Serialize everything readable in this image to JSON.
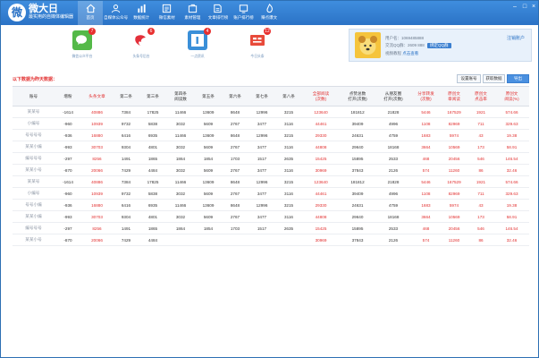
{
  "app": {
    "title": "微大日",
    "subtitle": "最实用的自媒体编辑器"
  },
  "nav": [
    {
      "label": "首页",
      "icon": "home-icon"
    },
    {
      "label": "自媒体公众号",
      "icon": "account-icon"
    },
    {
      "label": "数据统计",
      "icon": "stats-icon"
    },
    {
      "label": "微信素材",
      "icon": "material-icon"
    },
    {
      "label": "素材管理",
      "icon": "manage-icon"
    },
    {
      "label": "文章排行榜",
      "icon": "ranking-icon"
    },
    {
      "label": "账户排行榜",
      "icon": "account-rank-icon"
    },
    {
      "label": "赚点爆文",
      "icon": "hot-icon"
    }
  ],
  "window_controls": [
    "–",
    "□",
    "×"
  ],
  "cards": [
    {
      "label": "微信公众平台",
      "badge": "7",
      "icon": "wechat-icon",
      "color": "#54b948"
    },
    {
      "label": "头条号后台",
      "badge": "6",
      "icon": "toutiao-icon",
      "color": "#ffffff"
    },
    {
      "label": "一点资讯",
      "badge": "4",
      "icon": "yidian-icon",
      "color": "#3a8fd8"
    },
    {
      "label": "今日头条",
      "badge": "12",
      "icon": "jinri-icon",
      "color": "#e84a3a"
    }
  ],
  "profile": {
    "user_line": "用户名：1069485888",
    "qq_line": "交流QQ群：2609 888",
    "bind_label": "绑定QQ群",
    "tip_line": "视频教程",
    "tip_link": "点击查看",
    "logout_label": "注销账户"
  },
  "section_title": "以下数据为昨天数据：",
  "toolbar": {
    "settings_label": "设置账号",
    "fetch_label": "获取数据",
    "export_label": "导出"
  },
  "table": {
    "headers": [
      "账号",
      "增粉",
      "头条文章",
      "第二条",
      "第三条",
      "第四条\n阅读数",
      "第五条",
      "第六条",
      "第七条",
      "第八条",
      "全部阅读\n(次数)",
      "点赞总数\n打开(次数)",
      "从朋友圈\n打开(次数)",
      "分享转发\n(次数)",
      "原创文\n章阅读",
      "原创文\n点击率",
      "原创文\n阅读(%)"
    ],
    "red_columns": [
      2,
      10,
      13,
      14,
      15,
      16
    ],
    "rows": [
      [
        "某某号",
        "-1614",
        "40886",
        "7384",
        "17825",
        "11466",
        "13609",
        "8648",
        "12996",
        "3215",
        "123640",
        "181812",
        "21828",
        "5446",
        "167529",
        "1921",
        "574.66"
      ],
      [
        "小编号",
        "-960",
        "10939",
        "9732",
        "5838",
        "3032",
        "5609",
        "2767",
        "3477",
        "3116",
        "44461",
        "39409",
        "4996",
        "1108",
        "82969",
        "711",
        "329.63"
      ],
      [
        "号号号号",
        "-936",
        "16880",
        "6416",
        "6935",
        "11466",
        "13609",
        "8648",
        "12996",
        "3215",
        "29330",
        "24631",
        "4759",
        "1683",
        "5974",
        "43",
        "19.38"
      ],
      [
        "某某小编",
        "-993",
        "30703",
        "9304",
        "4801",
        "3032",
        "5609",
        "2767",
        "3477",
        "3116",
        "44808",
        "29640",
        "18168",
        "3664",
        "10569",
        "173",
        "58.91"
      ],
      [
        "编号号号",
        "-297",
        "8256",
        "1491",
        "1865",
        "1864",
        "1854",
        "1703",
        "1517",
        "2635",
        "15425",
        "15895",
        "2533",
        "468",
        "20456",
        "546",
        "146.54"
      ],
      [
        "某某小号",
        "-870",
        "20066",
        "7429",
        "4484",
        "3032",
        "5609",
        "2767",
        "3477",
        "3116",
        "30969",
        "37843",
        "2126",
        "574",
        "11260",
        "86",
        "32.46"
      ],
      [
        "某某号",
        "-1614",
        "40886",
        "7384",
        "17825",
        "11466",
        "13609",
        "8648",
        "12996",
        "3215",
        "123640",
        "181812",
        "21828",
        "5446",
        "167529",
        "1921",
        "574.66"
      ],
      [
        "小编号",
        "-960",
        "10939",
        "9732",
        "5838",
        "3032",
        "5609",
        "2767",
        "3477",
        "3116",
        "44461",
        "39409",
        "4996",
        "1108",
        "82969",
        "711",
        "329.63"
      ],
      [
        "号号小编",
        "-936",
        "16880",
        "6416",
        "6935",
        "11466",
        "13609",
        "8648",
        "12996",
        "3215",
        "29330",
        "24631",
        "4759",
        "1683",
        "5974",
        "43",
        "19.38"
      ],
      [
        "某某小编",
        "-993",
        "30703",
        "9304",
        "4801",
        "3032",
        "5609",
        "2767",
        "3477",
        "3116",
        "44808",
        "29640",
        "18168",
        "3664",
        "10569",
        "173",
        "58.91"
      ],
      [
        "编号号号",
        "-297",
        "8256",
        "1491",
        "1865",
        "1864",
        "1854",
        "1703",
        "1517",
        "2635",
        "15425",
        "15895",
        "2533",
        "468",
        "20456",
        "546",
        "146.54"
      ],
      [
        "某某小号",
        "-870",
        "20066",
        "7429",
        "4484",
        "",
        "",
        "",
        "",
        "",
        "30969",
        "37843",
        "2126",
        "574",
        "11260",
        "86",
        "32.46"
      ]
    ]
  },
  "colors": {
    "accent": "#2b73c6",
    "red": "#e23030"
  }
}
